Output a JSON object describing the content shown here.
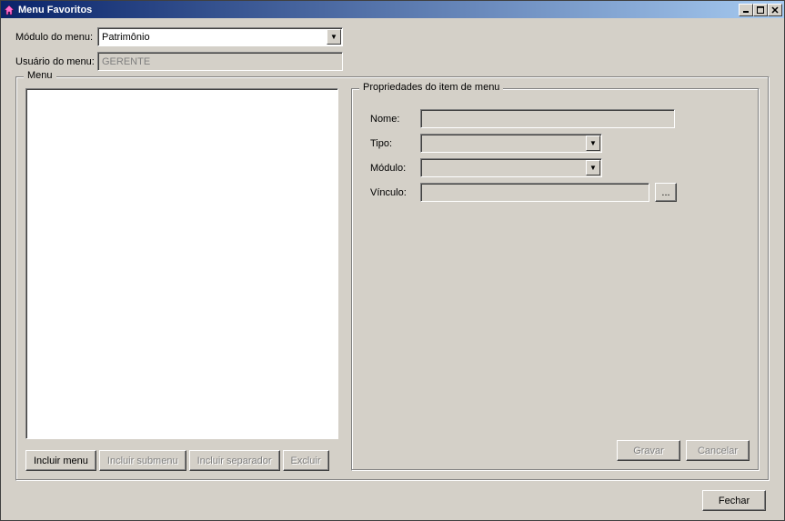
{
  "window": {
    "title": "Menu Favoritos"
  },
  "header": {
    "modulo_label": "Módulo do menu:",
    "modulo_value": "Patrimônio",
    "usuario_label": "Usuário do menu:",
    "usuario_value": "GERENTE"
  },
  "menu_section": {
    "legend": "Menu",
    "buttons": {
      "incluir_menu": "Incluir menu",
      "incluir_submenu": "Incluir submenu",
      "incluir_separador": "Incluir separador",
      "excluir": "Excluir"
    }
  },
  "props_section": {
    "legend": "Propriedades do item de menu",
    "nome_label": "Nome:",
    "nome_value": "",
    "tipo_label": "Tipo:",
    "tipo_value": "",
    "modulo_label": "Módulo:",
    "modulo_value": "",
    "vinculo_label": "Vínculo:",
    "vinculo_value": "",
    "browse_label": "...",
    "gravar": "Gravar",
    "cancelar": "Cancelar"
  },
  "footer": {
    "fechar": "Fechar"
  }
}
